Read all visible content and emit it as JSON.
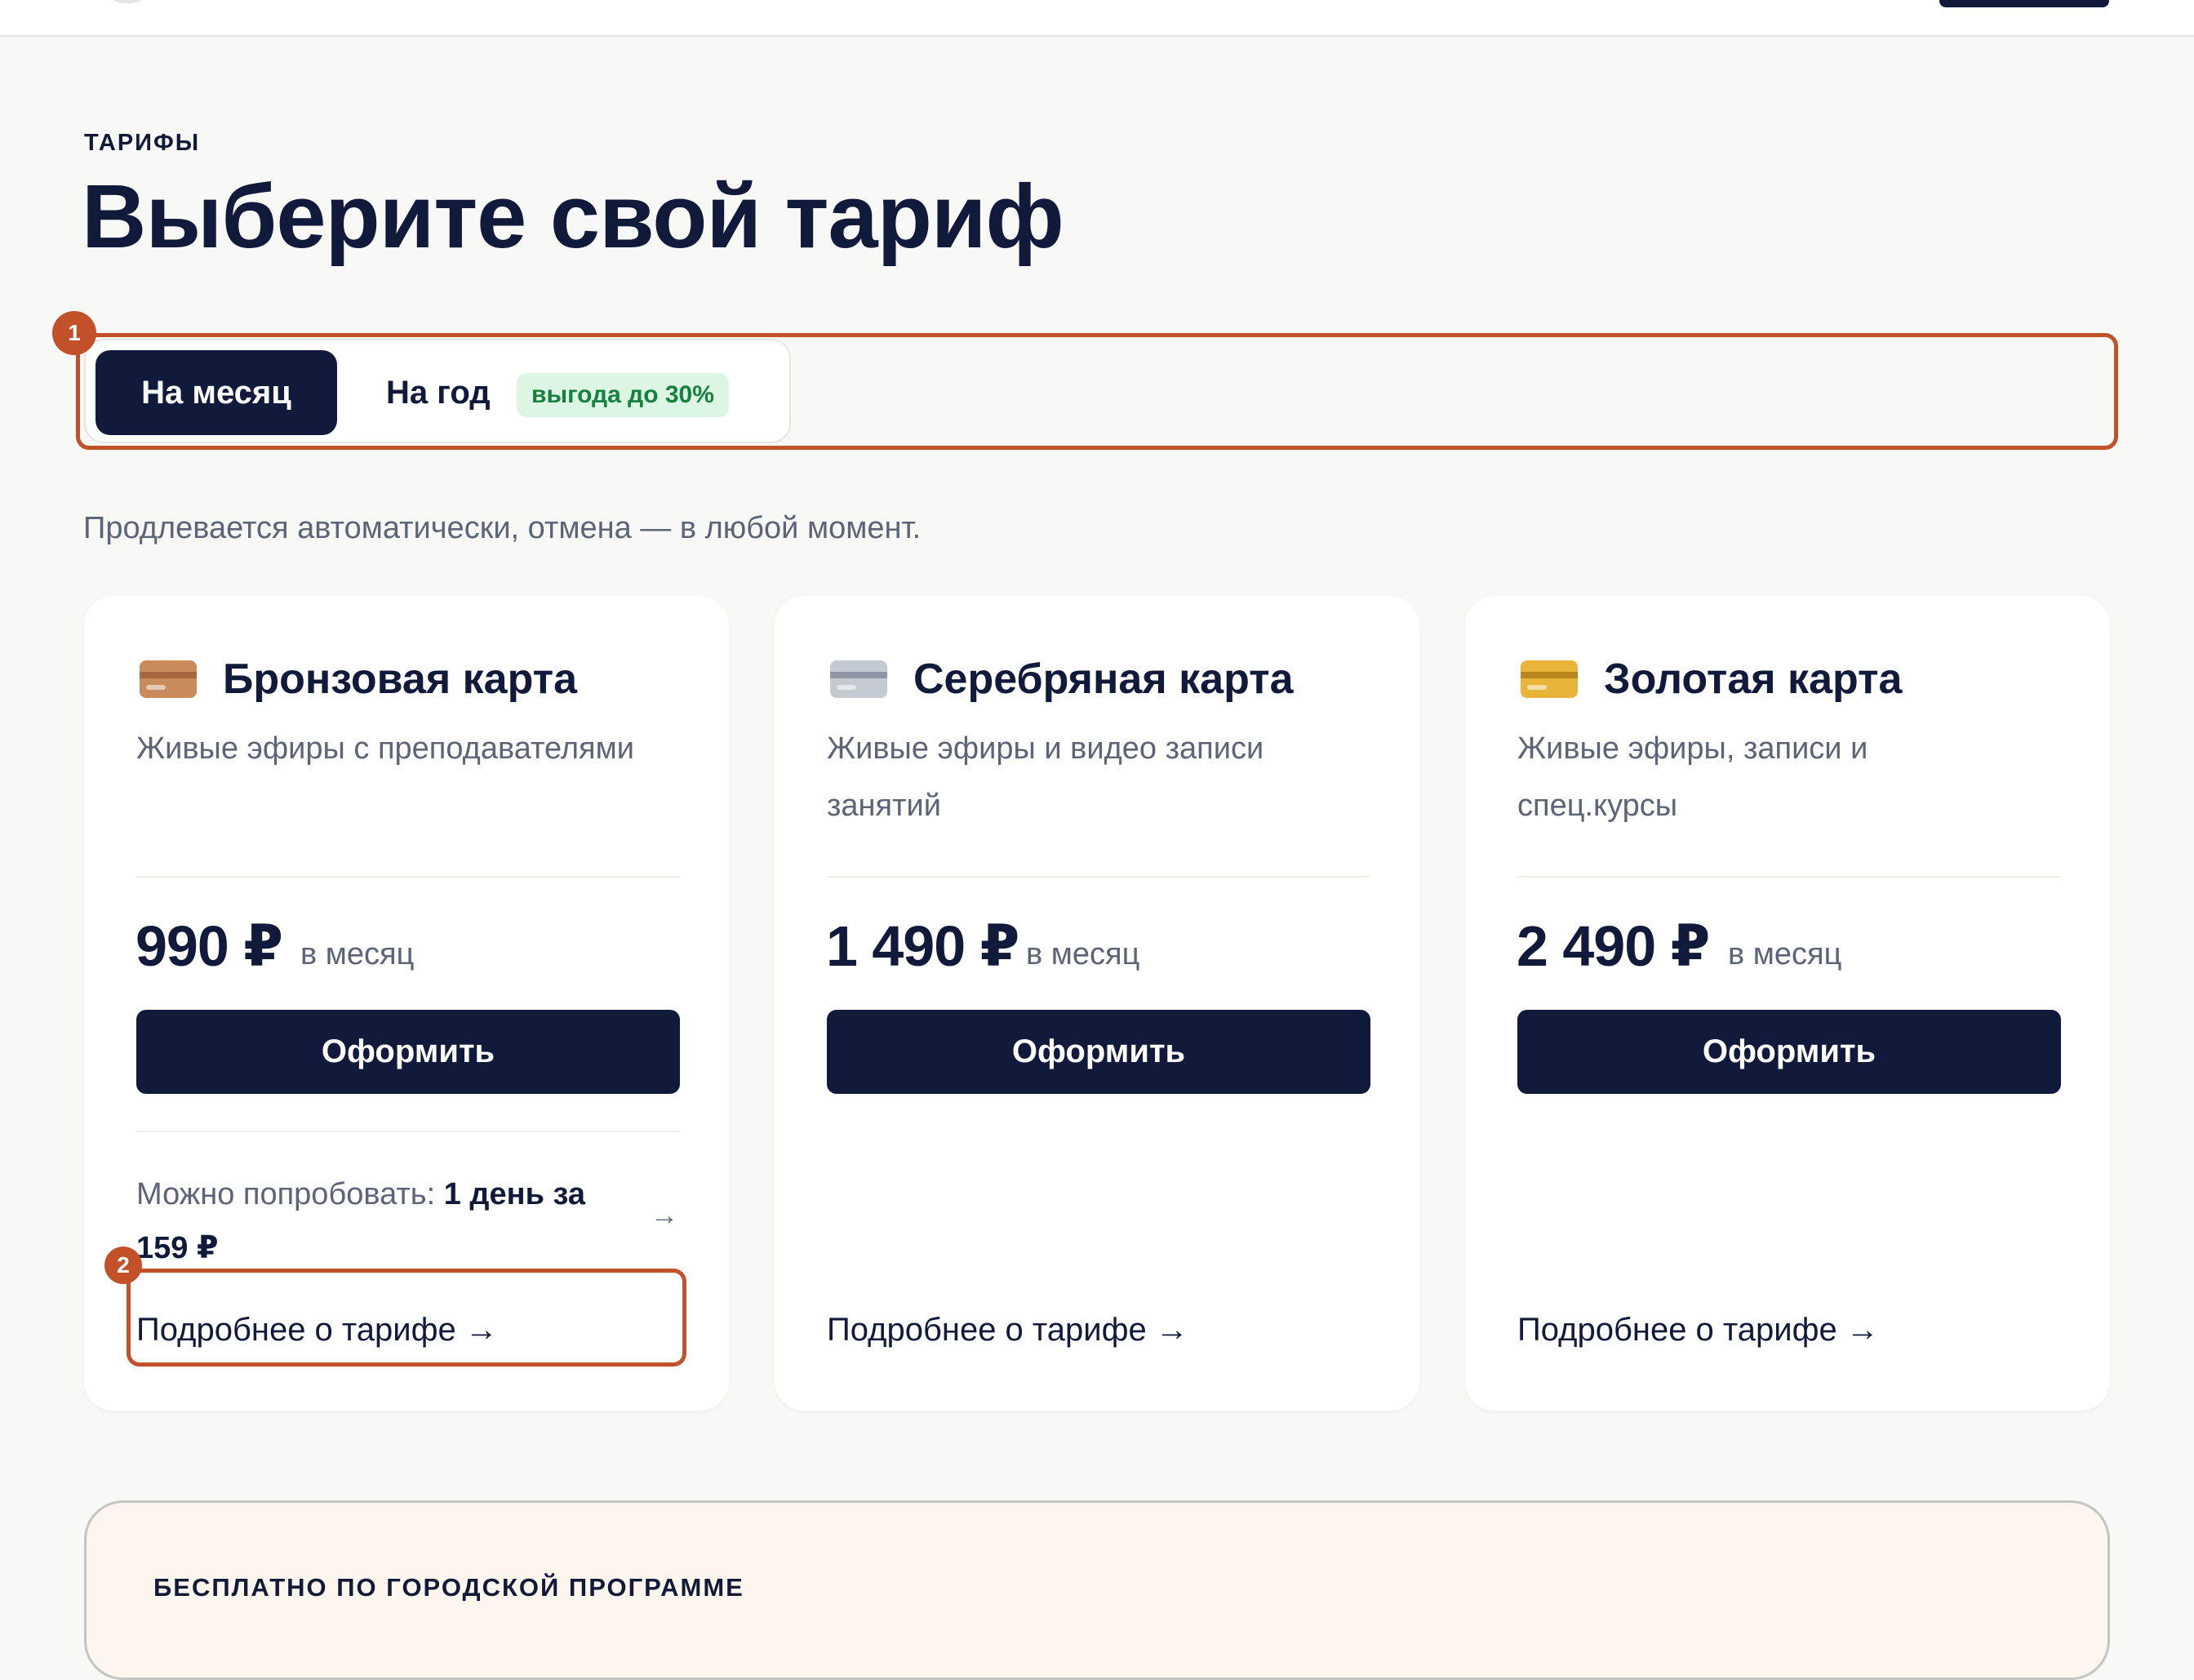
{
  "section": {
    "eyebrow": "ТАРИФЫ",
    "title": "Выберите свой тариф",
    "note": "Продлевается автоматически, отмена — в любой момент."
  },
  "billing_toggle": {
    "month_label": "На месяц",
    "year_label": "На год",
    "year_badge": "выгода до 30%",
    "selected": "month"
  },
  "annotations": [
    "1",
    "2"
  ],
  "plans": [
    {
      "name": "Бронзовая карта",
      "description": "Живые эфиры с преподавателями",
      "price": "990 ₽",
      "period": "в месяц",
      "cta": "Оформить",
      "trial_prefix": "Можно попробовать: ",
      "trial_offer": "1 день за 159 ₽",
      "trial_arrow": "→",
      "more_link": "Подробнее о тарифе →",
      "icon": "bronze-card-icon",
      "icon_color": "#c98a5c",
      "stripe_color": "#a8673f"
    },
    {
      "name": "Серебряная карта",
      "description": "Живые эфиры и видео записи занятий",
      "price": "1 490 ₽",
      "period": "в месяц",
      "cta": "Оформить",
      "more_link": "Подробнее о тарифе →",
      "icon": "silver-card-icon",
      "icon_color": "#c5c9d1",
      "stripe_color": "#8f96a3"
    },
    {
      "name": "Золотая карта",
      "description": "Живые эфиры, записи и спец.курсы",
      "price": "2 490 ₽",
      "period": "в месяц",
      "cta": "Оформить",
      "more_link": "Подробнее о тарифе →",
      "icon": "gold-card-icon",
      "icon_color": "#e9b43a",
      "stripe_color": "#b8861a"
    }
  ],
  "free_program": {
    "label": "БЕСПЛАТНО ПО ГОРОДСКОЙ ПРОГРАММЕ"
  },
  "colors": {
    "navy": "#111a3b",
    "annotation": "#c2512a",
    "badge_bg": "#dcf6e3",
    "badge_text": "#16803f"
  }
}
